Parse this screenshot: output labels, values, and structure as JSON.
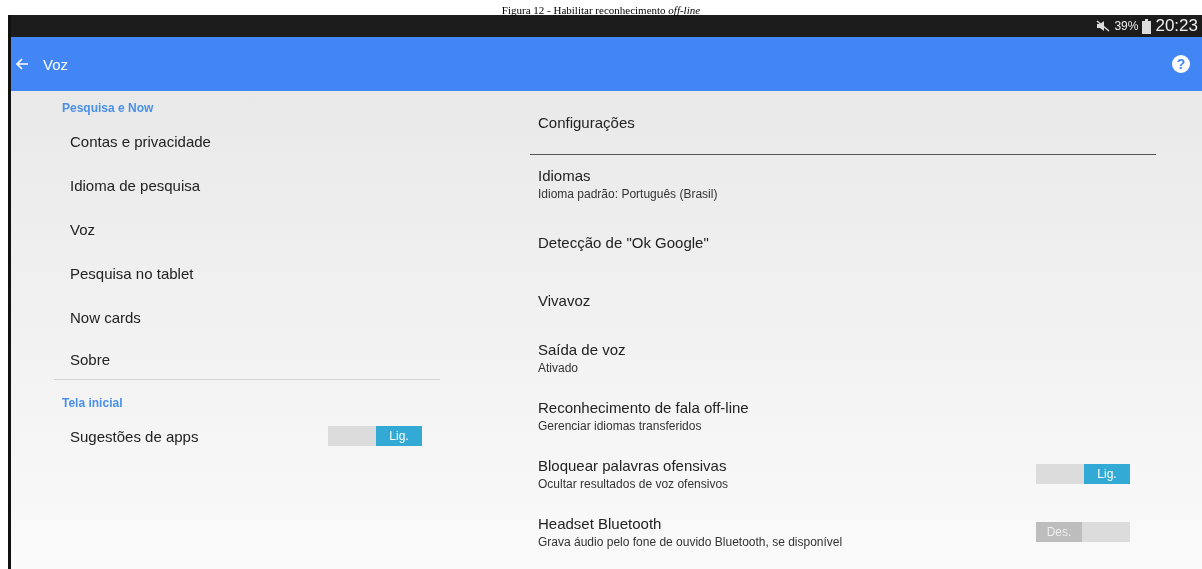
{
  "caption": {
    "text": "Figura 12 - Habilitar reconhecimento *off-line*"
  },
  "status_bar": {
    "battery": "39%",
    "time": "20:23"
  },
  "app_bar": {
    "title": "Voz",
    "help": "?"
  },
  "sidebar": {
    "sections": [
      {
        "header": "Pesquisa e Now",
        "items": [
          {
            "label": "Contas e privacidade"
          },
          {
            "label": "Idioma de pesquisa"
          },
          {
            "label": "Voz"
          },
          {
            "label": "Pesquisa no tablet"
          },
          {
            "label": "Now cards"
          },
          {
            "label": "Sobre"
          }
        ]
      },
      {
        "header": "Tela inicial",
        "items": [
          {
            "label": "Sugestões de apps",
            "toggle": {
              "on": true,
              "label": "Lig."
            }
          }
        ]
      }
    ]
  },
  "settings": {
    "title": "Configurações",
    "items": [
      {
        "title": "Idiomas",
        "subtitle": "Idioma padrão: Português (Brasil)"
      },
      {
        "title": "Detecção de \"Ok Google\""
      },
      {
        "title": "Vivavoz"
      },
      {
        "title": "Saída de voz",
        "subtitle": "Ativado"
      },
      {
        "title": "Reconhecimento de fala off-line",
        "subtitle": "Gerenciar idiomas transferidos"
      },
      {
        "title": "Bloquear palavras ofensivas",
        "subtitle": "Ocultar resultados de voz ofensivos",
        "toggle": {
          "on": true,
          "label": "Lig."
        }
      },
      {
        "title": "Headset Bluetooth",
        "subtitle": "Grava áudio pelo fone de ouvido Bluetooth, se disponível",
        "toggle": {
          "on": false,
          "label": "Des."
        }
      }
    ]
  }
}
